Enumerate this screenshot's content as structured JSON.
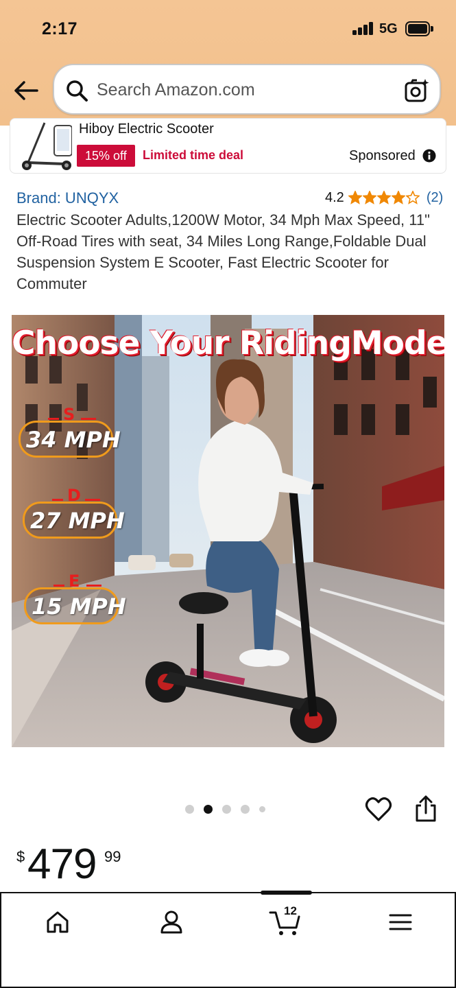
{
  "status_bar": {
    "time": "2:17",
    "network": "5G"
  },
  "search": {
    "placeholder": "Search Amazon.com"
  },
  "sponsored": {
    "title": "Hiboy Electric Scooter",
    "discount_badge": "15% off",
    "deal_text": "Limited time deal",
    "label": "Sponsored"
  },
  "product": {
    "brand": "Brand: UNQYX",
    "rating": "4.2",
    "rating_value": 4.2,
    "review_count": "(2)",
    "title": "Electric Scooter Adults,1200W Motor, 34 Mph Max Speed, 11\" Off-Road Tires with seat, 34 Miles Long Range,Foldable Dual Suspension System E Scooter, Fast Electric Scooter for Commuter"
  },
  "image": {
    "headline": "Choose Your RidingMode",
    "modes": [
      {
        "letter": "S",
        "speed": "34 MPH"
      },
      {
        "letter": "D",
        "speed": "27 MPH"
      },
      {
        "letter": "E",
        "speed": "15 MPH"
      }
    ]
  },
  "carousel": {
    "total": 5,
    "active_index": 1
  },
  "price": {
    "symbol": "$",
    "whole": "479",
    "fraction": "99"
  },
  "bottom_nav": {
    "items": [
      "home-icon",
      "account-icon",
      "cart-icon",
      "menu-icon"
    ],
    "cart_count": "12"
  },
  "colors": {
    "header_bg": "#f2c08c",
    "link": "#2162a1",
    "deal_red": "#cc0c39",
    "star": "#f08804"
  }
}
